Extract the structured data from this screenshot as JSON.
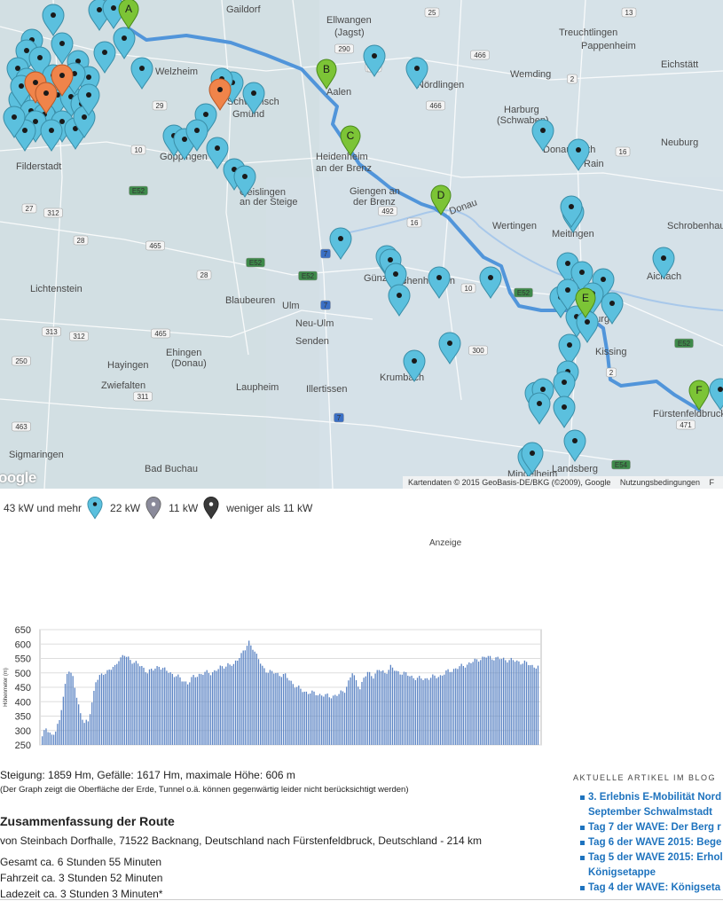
{
  "map": {
    "cities": [
      {
        "label": "Gaildorf"
      },
      {
        "label": "Ellwangen"
      },
      {
        "label": "(Jagst)"
      },
      {
        "label": "Welzheim"
      },
      {
        "label": "Aalen"
      },
      {
        "label": "Nördlingen"
      },
      {
        "label": "Wemding"
      },
      {
        "label": "Treuchtlingen"
      },
      {
        "label": "Pappenheim"
      },
      {
        "label": "Eichstätt"
      },
      {
        "label": "Schwäbisch"
      },
      {
        "label": "Gmünd"
      },
      {
        "label": "Harburg"
      },
      {
        "label": "(Schwaben)"
      },
      {
        "label": "Donauwörth"
      },
      {
        "label": "Rain"
      },
      {
        "label": "Neuburg"
      },
      {
        "label": "Filderstadt"
      },
      {
        "label": "Göppingen"
      },
      {
        "label": "Heidenheim"
      },
      {
        "label": "an der Brenz"
      },
      {
        "label": "Geislingen"
      },
      {
        "label": "an der Steige"
      },
      {
        "label": "Giengen an"
      },
      {
        "label": "der Brenz"
      },
      {
        "label": "Wertingen"
      },
      {
        "label": "Meitingen"
      },
      {
        "label": "Schrobenhausen"
      },
      {
        "label": "Lichtenstein"
      },
      {
        "label": "Blaubeuren"
      },
      {
        "label": "Ulm"
      },
      {
        "label": "Günzburg"
      },
      {
        "label": "Aichach"
      },
      {
        "label": "Ichenhausen"
      },
      {
        "label": "Neu-Ulm"
      },
      {
        "label": "Senden"
      },
      {
        "label": "Augsburg"
      },
      {
        "label": "Ehingen"
      },
      {
        "label": "(Donau)"
      },
      {
        "label": "Hayingen"
      },
      {
        "label": "Zwiefalten"
      },
      {
        "label": "Laupheim"
      },
      {
        "label": "Illertissen"
      },
      {
        "label": "Krumbach"
      },
      {
        "label": "Kissing"
      },
      {
        "label": "Fürstenfeldbruck"
      },
      {
        "label": "Sigmaringen"
      },
      {
        "label": "Bad Buchau"
      },
      {
        "label": "Mindelheim"
      },
      {
        "label": "Landsberg"
      },
      {
        "label": "Donau"
      }
    ],
    "road_numbers": [
      "25",
      "13",
      "290",
      "25",
      "466",
      "2",
      "29",
      "466",
      "29",
      "10",
      "16",
      "E52",
      "492",
      "16",
      "27",
      "312",
      "28",
      "465",
      "E52",
      "28",
      "7",
      "E52",
      "10",
      "E52",
      "7",
      "300",
      "313",
      "312",
      "465",
      "250",
      "311",
      "463",
      "471",
      "E54",
      "7",
      "2",
      "E52"
    ],
    "waypoints": [
      "A",
      "B",
      "C",
      "D",
      "E",
      "F"
    ],
    "colors": {
      "route": "#4a90d9",
      "pin_fast": "#5bc0de",
      "pin_22": "#8a8a9a",
      "pin_11": "#3a3a3a",
      "pin_orange": "#f0844a",
      "waypoint": "#7cc436"
    },
    "google_logo": "oogle",
    "attribution": [
      "Kartendaten © 2015 GeoBasis-DE/BKG (©2009), Google",
      "Nutzungsbedingungen",
      "F"
    ]
  },
  "legend": [
    {
      "label": "43 kW und mehr",
      "icon": "marker-cyan-icon",
      "color": "#5bc0de"
    },
    {
      "label": "22 kW",
      "icon": "marker-gray-icon",
      "color": "#8a8a9a"
    },
    {
      "label": "11 kW",
      "icon": "marker-dark-icon",
      "color": "#3a3a3a"
    },
    {
      "label": "weniger als 11 kW",
      "icon": "",
      "color": ""
    }
  ],
  "ad_label": "Anzeige",
  "chart_data": {
    "type": "bar",
    "ylabel": "Höhenmeter (m)",
    "ylim": [
      250,
      650
    ],
    "yticks": [
      650,
      600,
      550,
      500,
      450,
      400,
      350,
      300,
      250
    ],
    "grid": true,
    "bar_color": "#5b84c4",
    "profile_anchors": [
      [
        0,
        280
      ],
      [
        2,
        305
      ],
      [
        5,
        285
      ],
      [
        7,
        300
      ],
      [
        9,
        330
      ],
      [
        11,
        420
      ],
      [
        13,
        500
      ],
      [
        14,
        510
      ],
      [
        16,
        480
      ],
      [
        18,
        420
      ],
      [
        20,
        360
      ],
      [
        22,
        325
      ],
      [
        24,
        330
      ],
      [
        26,
        400
      ],
      [
        28,
        470
      ],
      [
        32,
        500
      ],
      [
        35,
        510
      ],
      [
        38,
        520
      ],
      [
        40,
        550
      ],
      [
        43,
        560
      ],
      [
        46,
        545
      ],
      [
        49,
        535
      ],
      [
        52,
        520
      ],
      [
        55,
        505
      ],
      [
        58,
        510
      ],
      [
        61,
        525
      ],
      [
        64,
        510
      ],
      [
        67,
        500
      ],
      [
        70,
        490
      ],
      [
        73,
        475
      ],
      [
        76,
        465
      ],
      [
        79,
        485
      ],
      [
        82,
        495
      ],
      [
        85,
        500
      ],
      [
        88,
        500
      ],
      [
        91,
        510
      ],
      [
        94,
        520
      ],
      [
        97,
        530
      ],
      [
        100,
        525
      ],
      [
        103,
        560
      ],
      [
        106,
        580
      ],
      [
        108,
        605
      ],
      [
        110,
        590
      ],
      [
        112,
        560
      ],
      [
        115,
        520
      ],
      [
        118,
        505
      ],
      [
        121,
        500
      ],
      [
        124,
        495
      ],
      [
        127,
        490
      ],
      [
        130,
        470
      ],
      [
        133,
        450
      ],
      [
        137,
        435
      ],
      [
        141,
        430
      ],
      [
        145,
        425
      ],
      [
        150,
        418
      ],
      [
        155,
        425
      ],
      [
        158,
        440
      ],
      [
        160,
        470
      ],
      [
        162,
        500
      ],
      [
        164,
        470
      ],
      [
        166,
        450
      ],
      [
        168,
        480
      ],
      [
        170,
        500
      ],
      [
        173,
        490
      ],
      [
        176,
        510
      ],
      [
        179,
        500
      ],
      [
        182,
        520
      ],
      [
        185,
        505
      ],
      [
        188,
        500
      ],
      [
        192,
        490
      ],
      [
        196,
        480
      ],
      [
        200,
        480
      ],
      [
        204,
        485
      ],
      [
        208,
        490
      ],
      [
        212,
        505
      ],
      [
        216,
        515
      ],
      [
        220,
        525
      ],
      [
        224,
        535
      ],
      [
        228,
        548
      ],
      [
        232,
        555
      ],
      [
        236,
        552
      ],
      [
        240,
        548
      ],
      [
        244,
        545
      ],
      [
        248,
        540
      ],
      [
        252,
        535
      ],
      [
        256,
        525
      ],
      [
        259,
        520
      ]
    ],
    "bar_count": 260
  },
  "stats": {
    "line1": "Steigung: 1859 Hm, Gefälle: 1617 Hm, maximale Höhe: 606 m",
    "line2": "(Der Graph zeigt die Oberfläche der Erde, Tunnel o.ä. können gegenwärtig leider nicht berücksichtigt werden)"
  },
  "summary": {
    "title": "Zusammenfassung der Route",
    "route": "von Steinbach Dorfhalle, 71522 Backnang, Deutschland nach Fürstenfeldbruck, Deutschland - 214 km",
    "total": "Gesamt ca. 6 Stunden 55 Minuten",
    "driving": "Fahrzeit ca. 3 Stunden 52 Minuten",
    "charging": "Ladezeit ca. 3 Stunden 3 Minuten*"
  },
  "sidebar": {
    "title": "AKTUELLE ARTIKEL IM BLOG",
    "articles": [
      "3. Erlebnis E-Mobilität Nord",
      "September Schwalmstadt",
      "Tag 7 der WAVE: Der Berg r",
      "Tag 6 der WAVE 2015: Bege",
      "Tag 5 der WAVE 2015: Erhol",
      "Königsetappe",
      "Tag 4 der WAVE: Königseta"
    ]
  }
}
